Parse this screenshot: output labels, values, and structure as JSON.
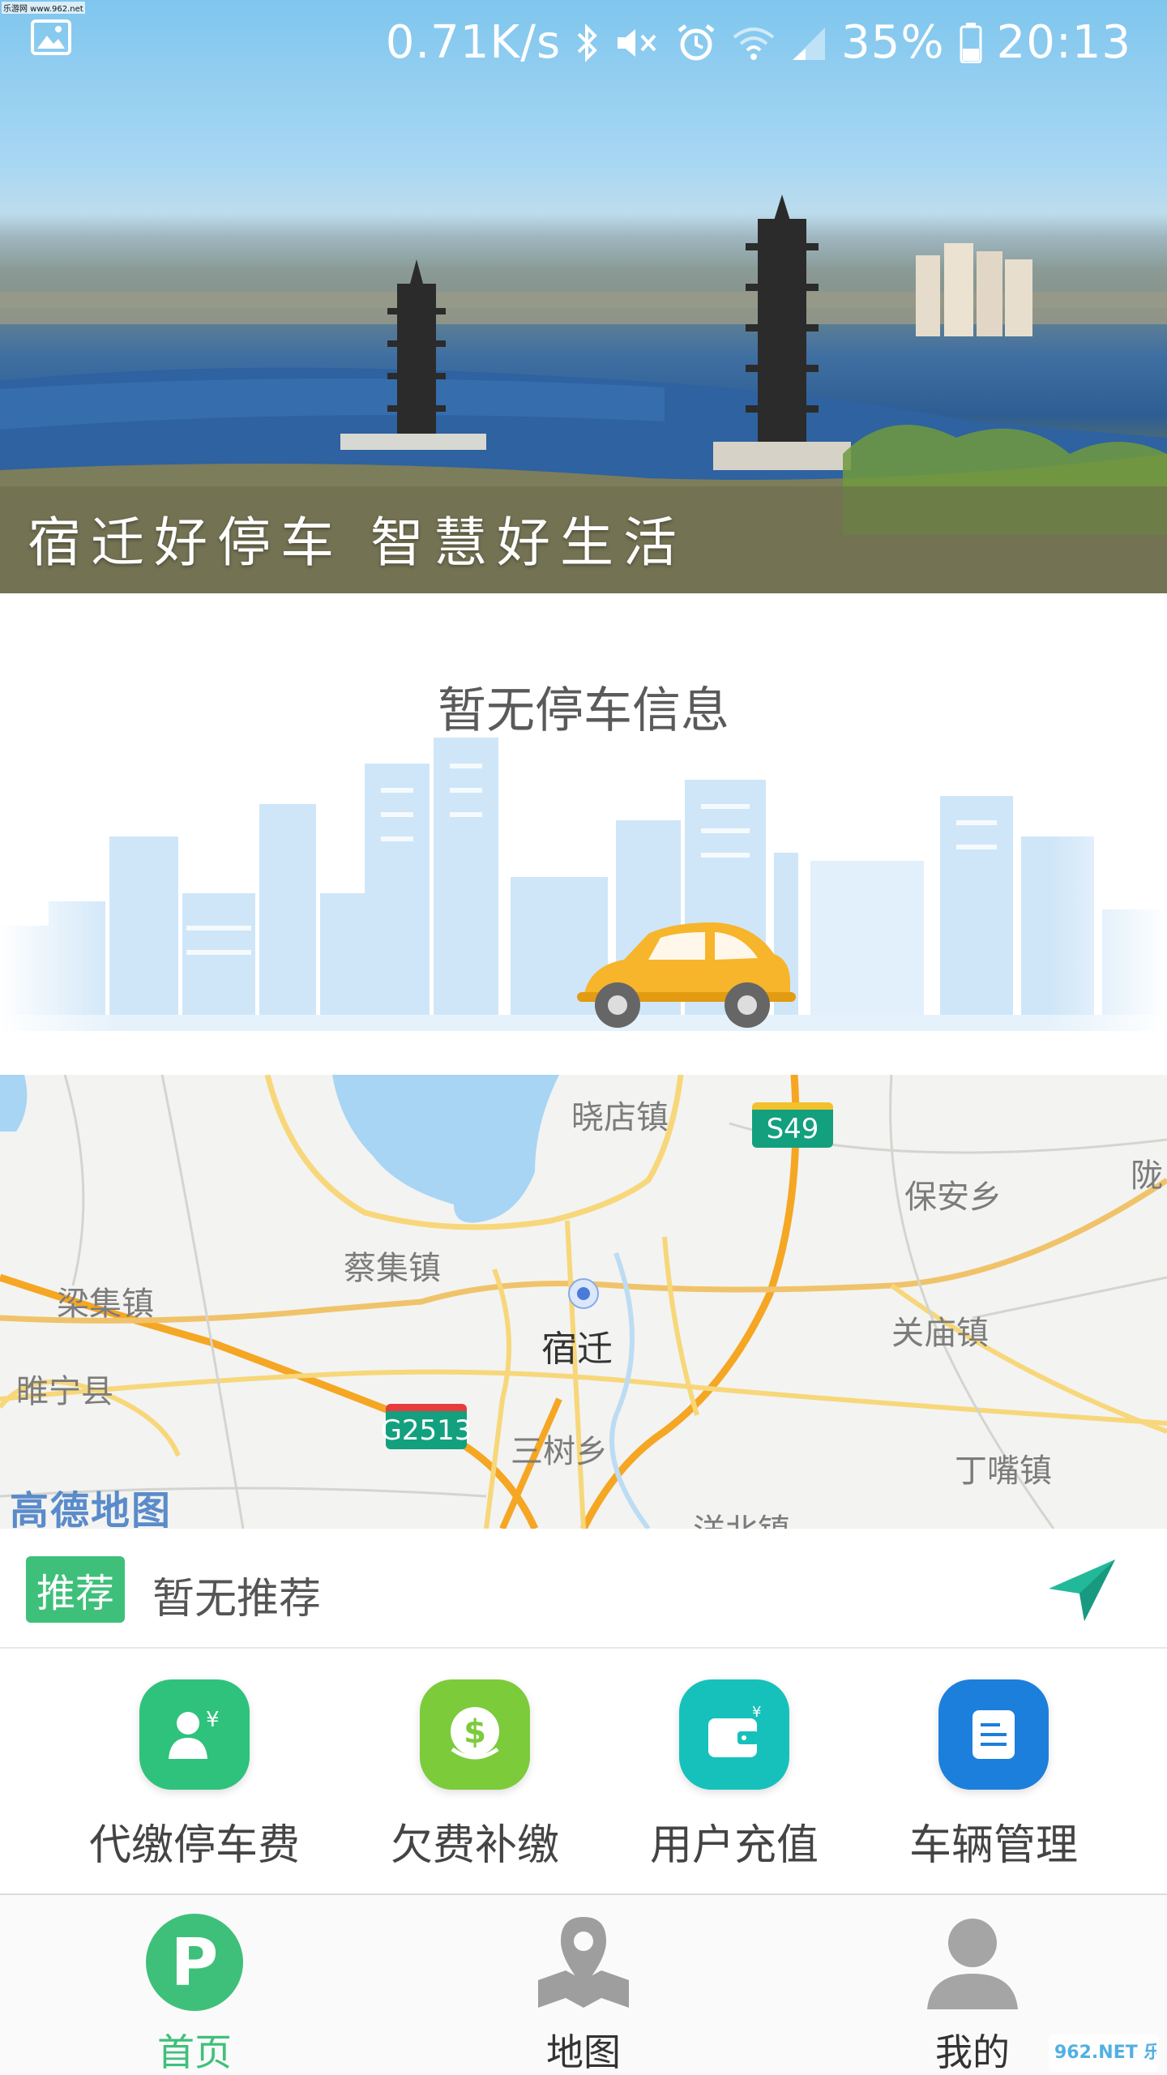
{
  "watermark": {
    "top_left": "乐游网 www.962.net",
    "bottom_right": "962.NET 乐游网"
  },
  "status_bar": {
    "network_speed": "0.71K/s",
    "battery": "35%",
    "time": "20:13",
    "icons": [
      "gallery-icon",
      "bluetooth-icon",
      "mute-icon",
      "alarm-icon",
      "wifi-icon",
      "signal-icon",
      "battery-icon"
    ]
  },
  "banner": {
    "caption": "宿迁好停车  智慧好生活"
  },
  "parking": {
    "empty_text": "暂无停车信息"
  },
  "map": {
    "labels": {
      "xiaodian": "晓店镇",
      "baoan": "保安乡",
      "long": "陇",
      "caiji": "蔡集镇",
      "liangji": "梁集镇",
      "suqian": "宿迁",
      "guanmiao": "关庙镇",
      "suining": "睢宁县",
      "sanshu": "三树乡",
      "dingzui": "丁嘴镇",
      "yangbei": "洋北镇"
    },
    "road_badges": {
      "s49": "S49",
      "g2513": "G2513"
    },
    "logo": "高德地图"
  },
  "recommend": {
    "tag": "推荐",
    "text": "暂无推荐"
  },
  "actions": [
    {
      "label": "代缴停车费",
      "icon": "user-yen-icon",
      "color": "#2fc27c"
    },
    {
      "label": "欠费补缴",
      "icon": "dollar-coin-icon",
      "color": "#7ccb3b"
    },
    {
      "label": "用户充值",
      "icon": "wallet-icon",
      "color": "#17c1bb"
    },
    {
      "label": "车辆管理",
      "icon": "document-icon",
      "color": "#1d7fdc"
    }
  ],
  "tabs": [
    {
      "label": "首页",
      "icon": "parking-icon",
      "active": true
    },
    {
      "label": "地图",
      "icon": "map-pin-icon",
      "active": false
    },
    {
      "label": "我的",
      "icon": "user-icon",
      "active": false
    }
  ],
  "colors": {
    "accent": "#3fc07a",
    "map_bg": "#f3f3f1"
  }
}
